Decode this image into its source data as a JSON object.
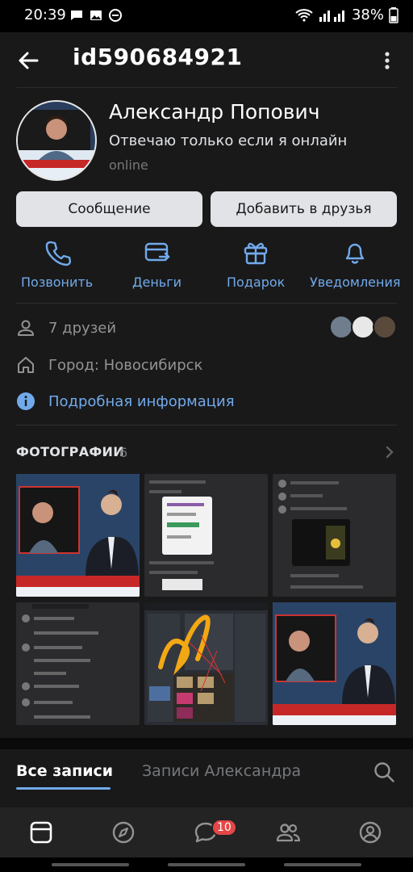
{
  "status_bar": {
    "time": "20:39",
    "battery": "38%",
    "icons": [
      "chat-icon",
      "image-icon",
      "dnd-icon",
      "wifi-icon",
      "signal-icon",
      "battery-icon"
    ]
  },
  "header": {
    "title": "id590684921",
    "back_icon": "arrow-left-icon",
    "menu_icon": "more-vertical-icon"
  },
  "profile": {
    "name": "Александр Попович",
    "status": "Отвечаю только если я онлайн",
    "presence": "online"
  },
  "buttons": {
    "message": "Сообщение",
    "add_friend": "Добавить в друзья"
  },
  "actions": [
    {
      "label": "Позвонить",
      "icon": "phone-icon"
    },
    {
      "label": "Деньги",
      "icon": "money-transfer-icon"
    },
    {
      "label": "Подарок",
      "icon": "gift-icon"
    },
    {
      "label": "Уведомления",
      "icon": "bell-icon"
    }
  ],
  "info": {
    "friends": "7 друзей",
    "city": "Город: Новосибирск",
    "details": "Подробная информация"
  },
  "photos": {
    "title": "ФОТОГРАФИИ",
    "count": "6"
  },
  "tabs": {
    "all_posts": "Все записи",
    "own_posts": "Записи Александра"
  },
  "bottom_nav": {
    "messages_badge": "10",
    "items": [
      "feed-icon",
      "discover-icon",
      "messages-icon",
      "friends-icon",
      "profile-icon"
    ]
  },
  "colors": {
    "background": "#19191a",
    "accent": "#71aaeb",
    "button_bg": "#e1e3e6",
    "badge": "#e64646"
  }
}
